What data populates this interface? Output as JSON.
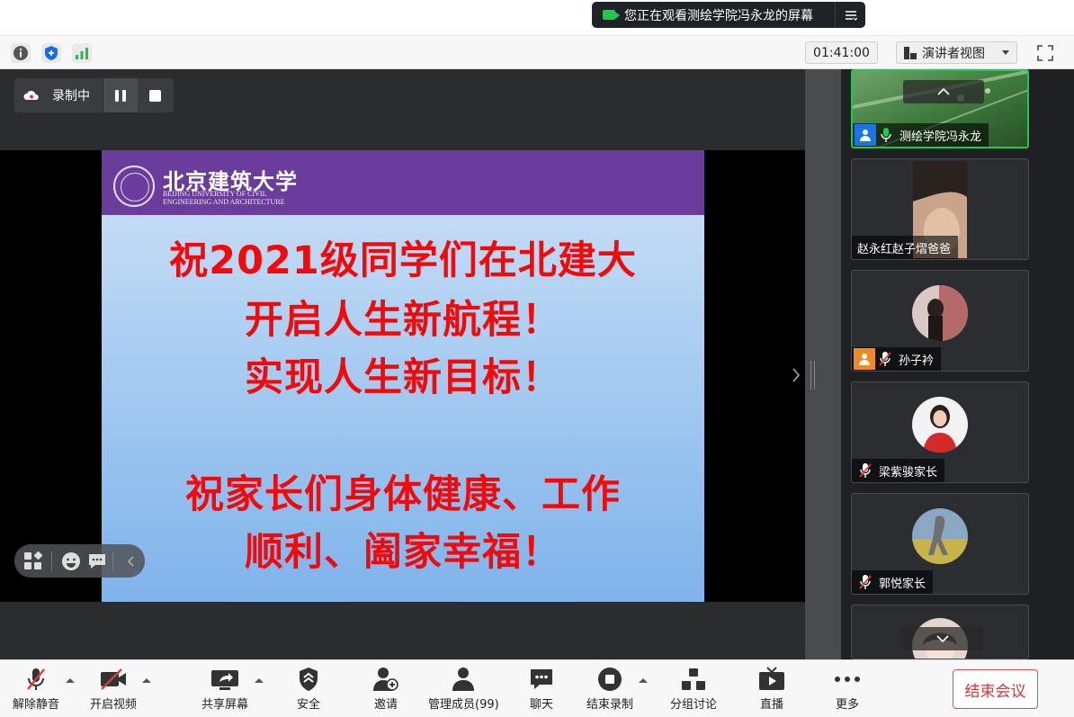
{
  "banner": {
    "text": "您正在观看测绘学院冯永龙的屏幕"
  },
  "header": {
    "timer": "01:41:00",
    "view_label": "演讲者视图"
  },
  "recording": {
    "label": "录制中"
  },
  "slide": {
    "university_cn": "北京建筑大学",
    "university_en_1": "BEIJING UNIVERSITY OF CIVIL",
    "university_en_2": "ENGINEERING AND ARCHITECTURE",
    "lines": [
      "祝2021级同学们在北建大",
      "开启人生新航程！",
      "实现人生新目标！",
      "祝家长们身体健康、工作",
      "顺利、阖家幸福！"
    ]
  },
  "participants": [
    {
      "name": "测绘学院冯永龙",
      "mic": "on",
      "badge": "host"
    },
    {
      "name": "赵永红赵子熠爸爸",
      "mic": "none",
      "badge": "none"
    },
    {
      "name": "孙子衿",
      "mic": "muted",
      "badge": "cohost"
    },
    {
      "name": "梁紫骏家长",
      "mic": "muted",
      "badge": "none"
    },
    {
      "name": "郭悦家长",
      "mic": "muted",
      "badge": "none"
    }
  ],
  "toolbar": {
    "unmute": "解除静音",
    "video": "开启视频",
    "share": "共享屏幕",
    "security": "安全",
    "invite": "邀请",
    "members": "管理成员(99)",
    "chat": "聊天",
    "end_record": "结束录制",
    "breakout": "分组讨论",
    "live": "直播",
    "more": "更多",
    "end_meeting": "结束会议"
  },
  "colors": {
    "accent_green": "#1fc94d",
    "slide_header": "#6a3c9c",
    "slide_text": "#f20a0a",
    "end_red": "#e03232"
  }
}
